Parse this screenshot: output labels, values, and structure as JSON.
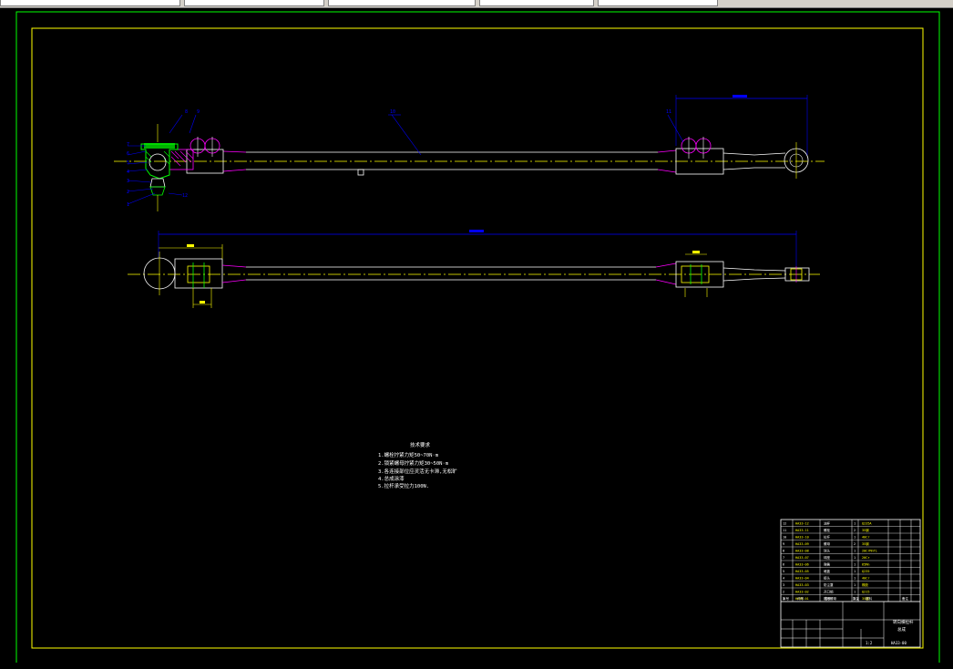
{
  "app": {
    "toolbar_fields": [
      "",
      "",
      "",
      "",
      ""
    ]
  },
  "drawing": {
    "balloons_top": [
      "8",
      "9",
      "10",
      "11",
      "7",
      "6",
      "5",
      "4",
      "3",
      "2",
      "1",
      "12"
    ],
    "tech_requirements": {
      "title": "技术要求",
      "items": [
        "1.螺栓拧紧力矩50~70N·m",
        "2.锁紧螺母拧紧力矩30~50N·m",
        "3.各连接部位应灵活无卡滞,无松旷",
        "4.总成涂漆",
        "5.拉杆承受拉力100N."
      ]
    },
    "title_block": {
      "drawing_title": "转向横拉杆",
      "subtitle": "总成",
      "drawing_no": "HA33-00",
      "scale": "1:2",
      "parts": [
        {
          "no": "12",
          "code": "HA33-12",
          "name": "油杯",
          "qty": "1",
          "material": "Q235A"
        },
        {
          "no": "11",
          "code": "HA33-11",
          "name": "螺栓",
          "qty": "2",
          "material": "35钢"
        },
        {
          "no": "10",
          "code": "HA33-10",
          "name": "拉杆",
          "qty": "1",
          "material": "40Cr"
        },
        {
          "no": "9",
          "code": "HA33-09",
          "name": "螺母",
          "qty": "2",
          "material": "35钢"
        },
        {
          "no": "8",
          "code": "HA33-08",
          "name": "球头",
          "qty": "1",
          "material": "20CrMnTi"
        },
        {
          "no": "7",
          "code": "HA33-07",
          "name": "球座",
          "qty": "1",
          "material": "20Cr"
        },
        {
          "no": "6",
          "code": "HA33-06",
          "name": "弹簧",
          "qty": "1",
          "material": "65Mn"
        },
        {
          "no": "5",
          "code": "HA33-05",
          "name": "堵盖",
          "qty": "1",
          "material": "Q235"
        },
        {
          "no": "4",
          "code": "HA33-04",
          "name": "接头",
          "qty": "1",
          "material": "40Cr"
        },
        {
          "no": "3",
          "code": "HA33-03",
          "name": "防尘罩",
          "qty": "1",
          "material": "橡胶"
        },
        {
          "no": "2",
          "code": "HA33-02",
          "name": "开口销",
          "qty": "1",
          "material": "Q215"
        },
        {
          "no": "1",
          "code": "HA33-01",
          "name": "槽形螺母",
          "qty": "1",
          "material": "35钢"
        }
      ],
      "header": [
        "序号",
        "代号",
        "名称",
        "数量",
        "材料",
        "备注"
      ]
    },
    "colors": {
      "background": "#000000",
      "outer_border": "#00ff00",
      "inner_border": "#ffff00",
      "outline": "#ffffff",
      "centerline": "#ffff00",
      "dimension": "#0000ff",
      "hidden": "#ff00ff",
      "hatch": "#00ff00"
    }
  }
}
